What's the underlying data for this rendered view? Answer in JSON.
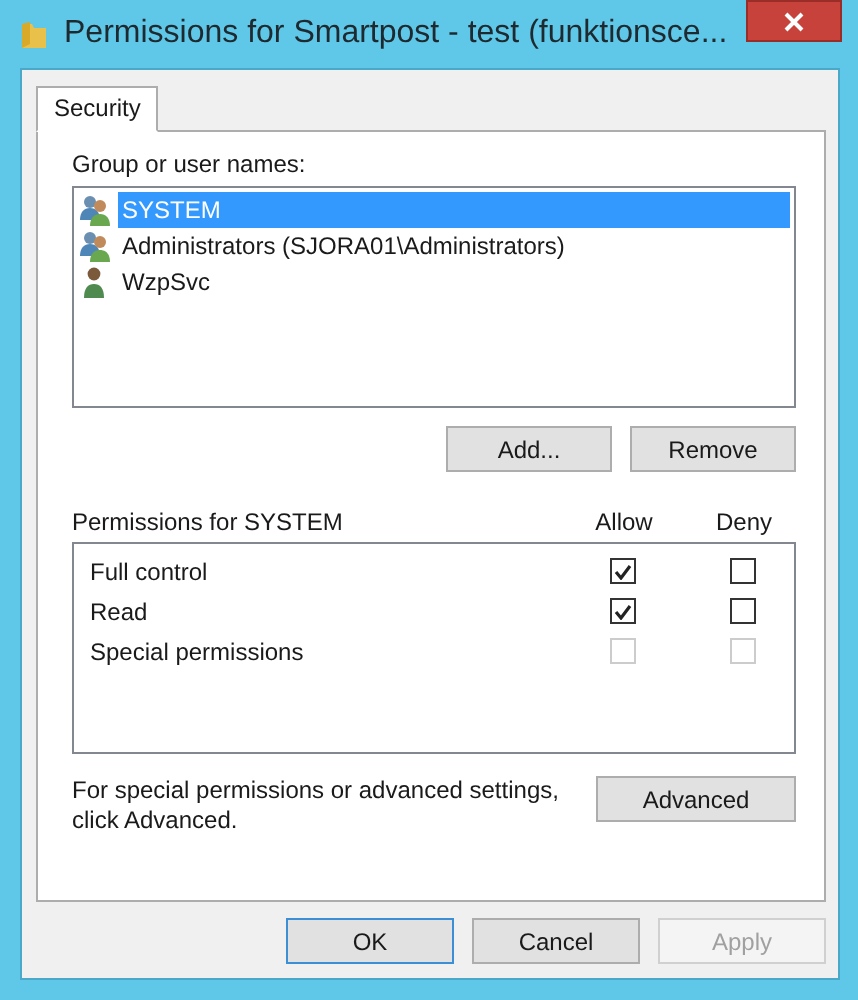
{
  "window": {
    "title": "Permissions for Smartpost - test (funktionsce..."
  },
  "tabs": [
    {
      "label": "Security",
      "selected": true
    }
  ],
  "group_label": "Group or user names:",
  "principals": [
    {
      "name": "SYSTEM",
      "kind": "group",
      "selected": true
    },
    {
      "name": "Administrators (SJORA01\\Administrators)",
      "kind": "group",
      "selected": false
    },
    {
      "name": "WzpSvc",
      "kind": "user",
      "selected": false
    }
  ],
  "principal_buttons": [
    "Add...",
    "Remove"
  ],
  "permissions": {
    "header": "Permissions for SYSTEM",
    "columns": [
      "Allow",
      "Deny"
    ],
    "rows": [
      {
        "name": "Full control",
        "allow": {
          "checked": true,
          "disabled": false
        },
        "deny": {
          "checked": false,
          "disabled": false
        }
      },
      {
        "name": "Read",
        "allow": {
          "checked": true,
          "disabled": false
        },
        "deny": {
          "checked": false,
          "disabled": false
        }
      },
      {
        "name": "Special permissions",
        "allow": {
          "checked": false,
          "disabled": true
        },
        "deny": {
          "checked": false,
          "disabled": true
        }
      }
    ]
  },
  "advanced": {
    "text": "For special permissions or advanced settings, click Advanced.",
    "button": "Advanced"
  },
  "dialog_buttons": [
    {
      "label": "OK",
      "default": true,
      "disabled": false
    },
    {
      "label": "Cancel",
      "default": false,
      "disabled": false
    },
    {
      "label": "Apply",
      "default": false,
      "disabled": true
    }
  ]
}
